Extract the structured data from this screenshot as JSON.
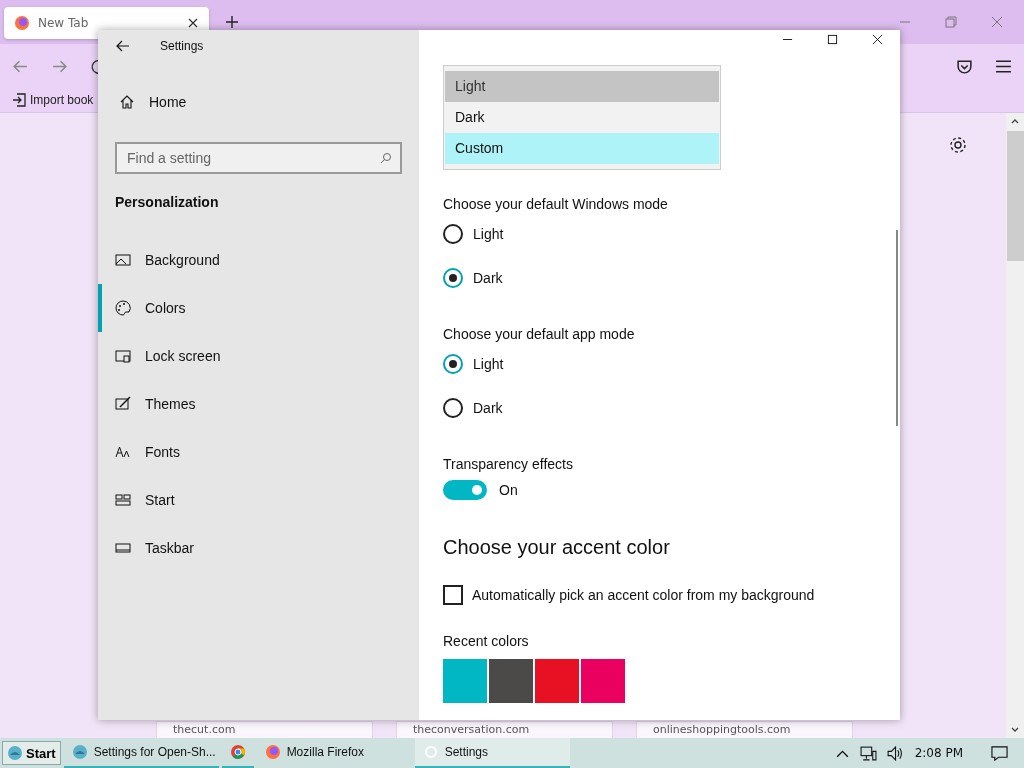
{
  "browser": {
    "tab": {
      "title": "New Tab",
      "selected": true
    },
    "bookmark": "Import book",
    "cards": [
      {
        "source": "thecut.com"
      },
      {
        "source": "theconversation.com"
      },
      {
        "source": "onlineshoppingtools.com"
      }
    ]
  },
  "settings": {
    "title": "Settings",
    "home": "Home",
    "search": {
      "placeholder": "Find a setting"
    },
    "section": "Personalization",
    "nav": [
      {
        "label": "Background",
        "selected": false
      },
      {
        "label": "Colors",
        "selected": true
      },
      {
        "label": "Lock screen",
        "selected": false
      },
      {
        "label": "Themes",
        "selected": false
      },
      {
        "label": "Fonts",
        "selected": false
      },
      {
        "label": "Start",
        "selected": false
      },
      {
        "label": "Taskbar",
        "selected": false
      }
    ],
    "color_menu": [
      {
        "label": "Light",
        "selected": true,
        "hovered": false
      },
      {
        "label": "Dark",
        "selected": false,
        "hovered": false
      },
      {
        "label": "Custom",
        "selected": false,
        "hovered": true
      }
    ],
    "windows_mode": {
      "label": "Choose your default Windows mode",
      "options": [
        {
          "label": "Light",
          "selected": false
        },
        {
          "label": "Dark",
          "selected": true
        }
      ]
    },
    "app_mode": {
      "label": "Choose your default app mode",
      "options": [
        {
          "label": "Light",
          "selected": true
        },
        {
          "label": "Dark",
          "selected": false
        }
      ]
    },
    "transparency": {
      "label": "Transparency effects",
      "on": true,
      "state": "On"
    },
    "accent_heading": "Choose your accent color",
    "auto_pick": {
      "label": "Automatically pick an accent color from my background",
      "checked": false
    },
    "recent_label": "Recent colors",
    "recent_colors": [
      {
        "color": "#00b7c3"
      },
      {
        "color": "#4c4a48"
      },
      {
        "color": "#e81123"
      },
      {
        "color": "#ea005e"
      }
    ]
  },
  "taskbar": {
    "start": "Start",
    "items": [
      {
        "label": "Settings for Open-Sh...",
        "selected": false
      },
      {
        "selected": false
      },
      {
        "label": "Mozilla Firefox",
        "selected": false
      },
      {
        "label": "Settings",
        "selected": true
      }
    ],
    "time": "2:08 PM"
  }
}
